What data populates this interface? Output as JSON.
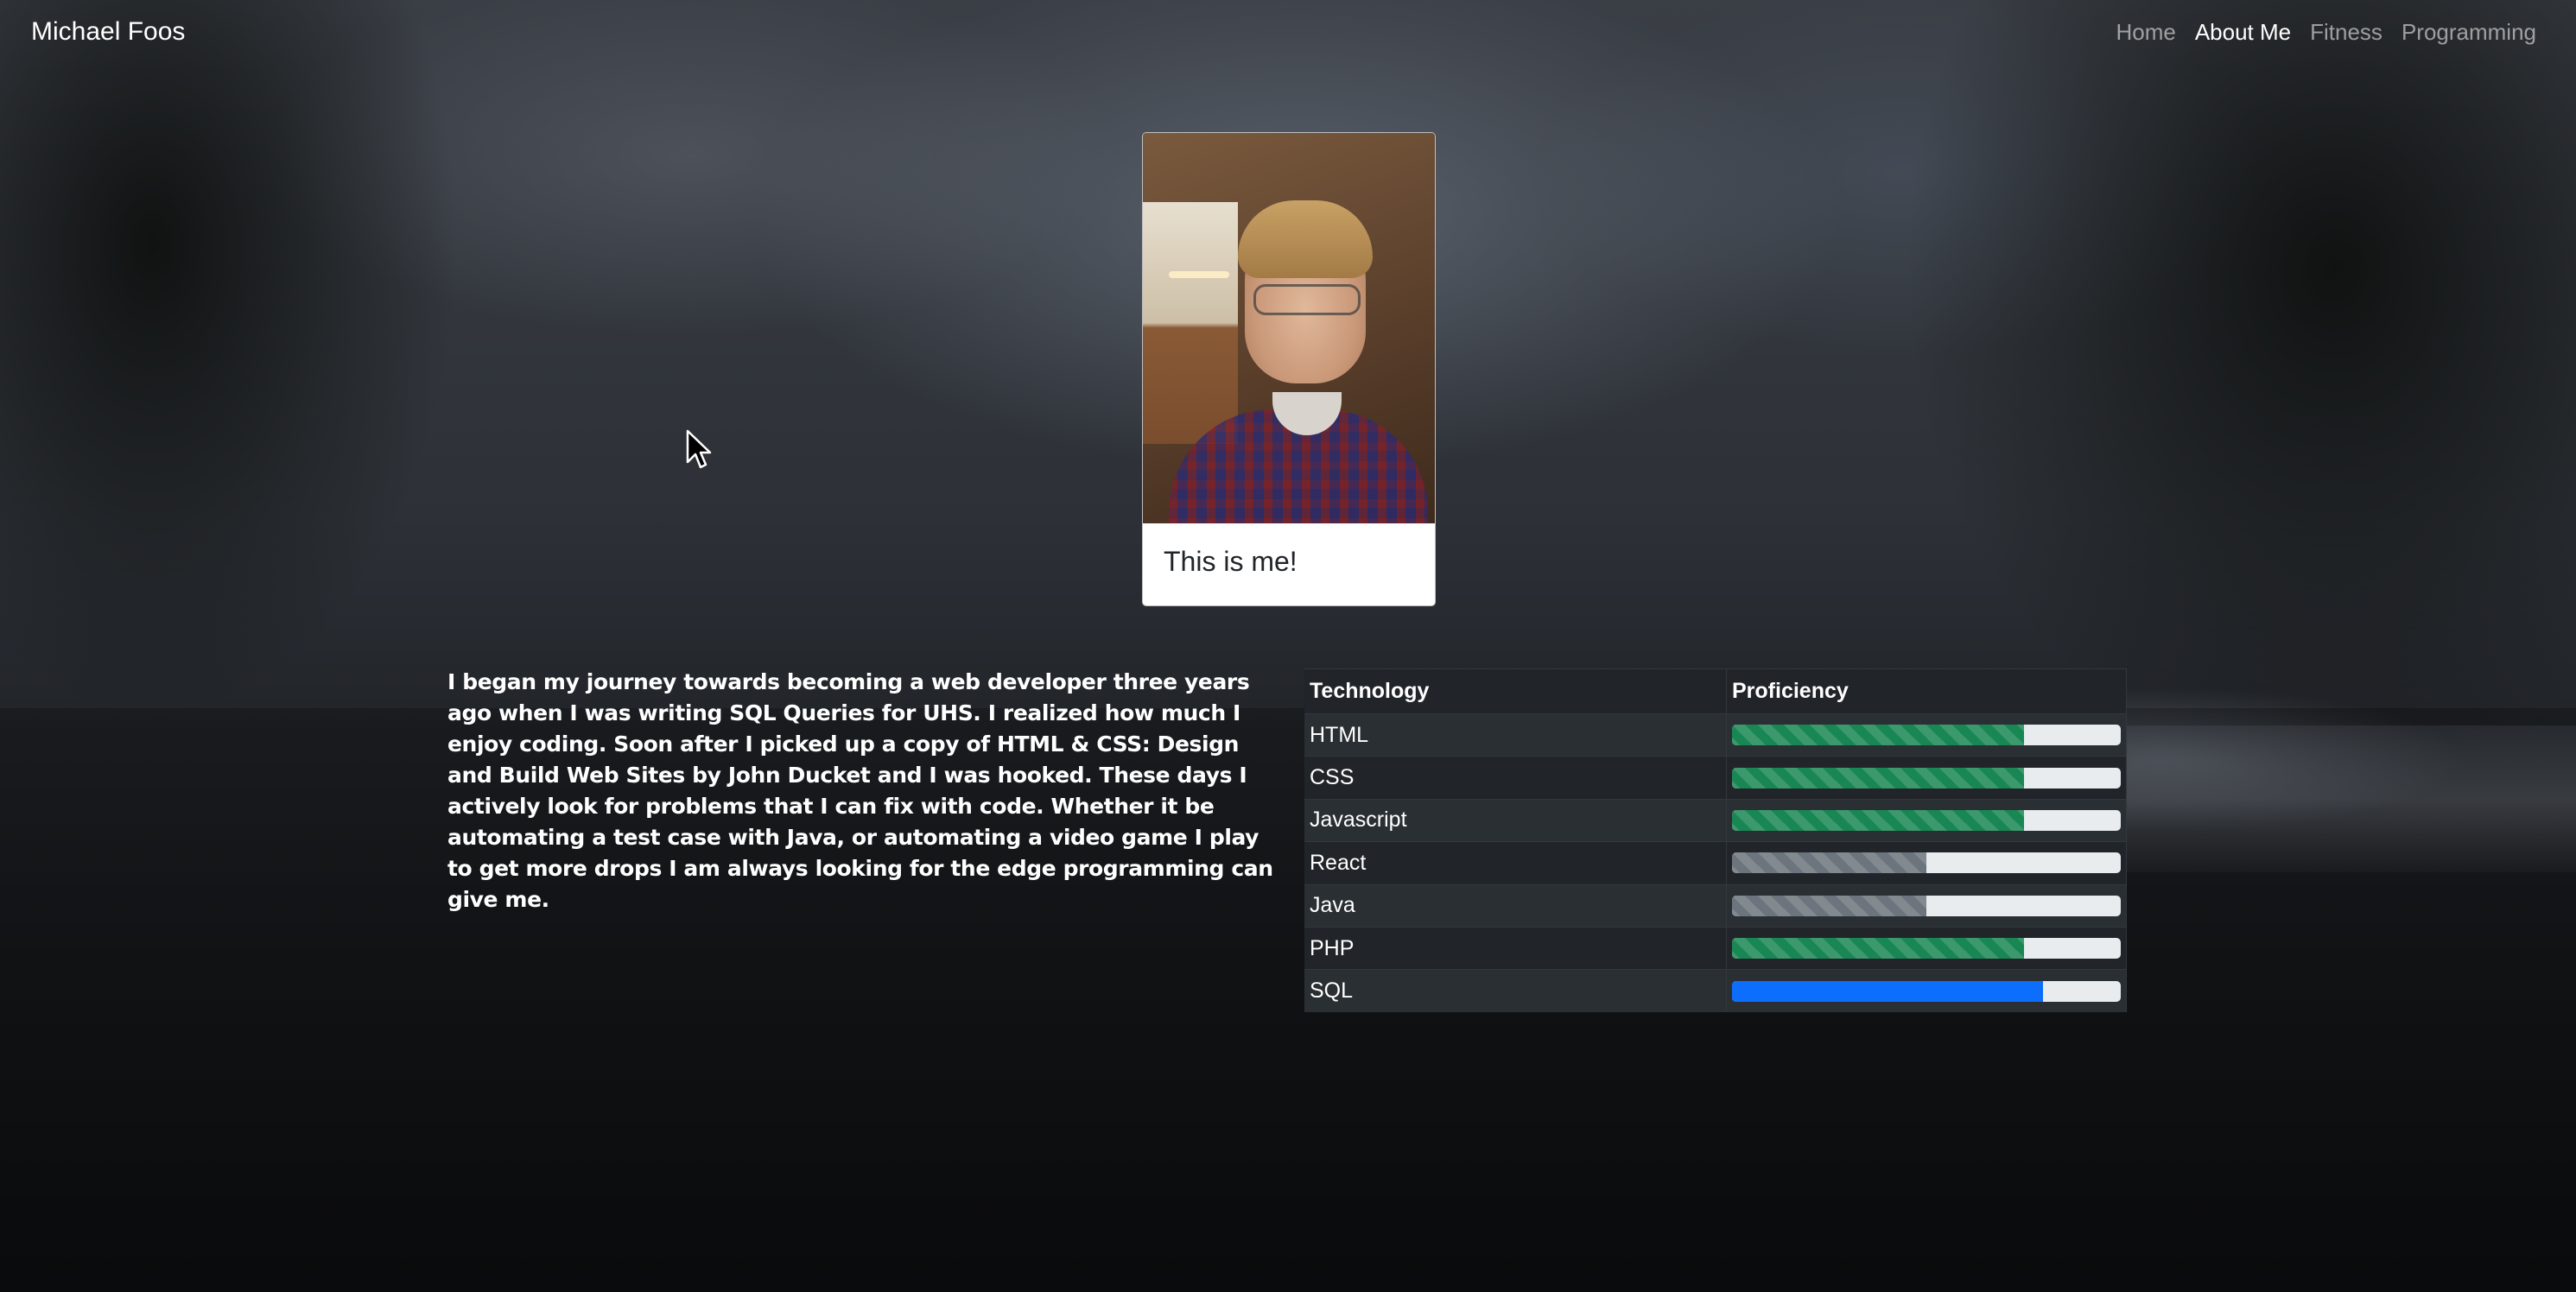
{
  "site": {
    "brand": "Michael Foos",
    "nav": [
      {
        "label": "Home",
        "active": false
      },
      {
        "label": "About Me",
        "active": true
      },
      {
        "label": "Fitness",
        "active": false
      },
      {
        "label": "Programming",
        "active": false
      }
    ]
  },
  "profile_card": {
    "caption": "This is me!"
  },
  "bio": {
    "text": "I began my journey towards becoming a web developer three years ago when I was writing SQL Queries for UHS. I realized how much I enjoy coding. Soon after I picked up a copy of HTML & CSS: Design and Build Web Sites by John Ducket and I was hooked. These days I actively look for problems that I can fix with code. Whether it be automating a test case with Java, or automating a video game I play to get more drops I am always looking for the edge programming can give me."
  },
  "skills_table": {
    "headers": [
      "Technology",
      "Proficiency"
    ],
    "rows": [
      {
        "technology": "HTML",
        "proficiency": 75,
        "color": "#198754",
        "striped": true
      },
      {
        "technology": "CSS",
        "proficiency": 75,
        "color": "#198754",
        "striped": true
      },
      {
        "technology": "Javascript",
        "proficiency": 75,
        "color": "#198754",
        "striped": true
      },
      {
        "technology": "React",
        "proficiency": 50,
        "color": "#6c757d",
        "striped": true
      },
      {
        "technology": "Java",
        "proficiency": 50,
        "color": "#6c757d",
        "striped": true
      },
      {
        "technology": "PHP",
        "proficiency": 75,
        "color": "#198754",
        "striped": true
      },
      {
        "technology": "SQL",
        "proficiency": 80,
        "color": "#0d6efd",
        "striped": false
      }
    ]
  }
}
